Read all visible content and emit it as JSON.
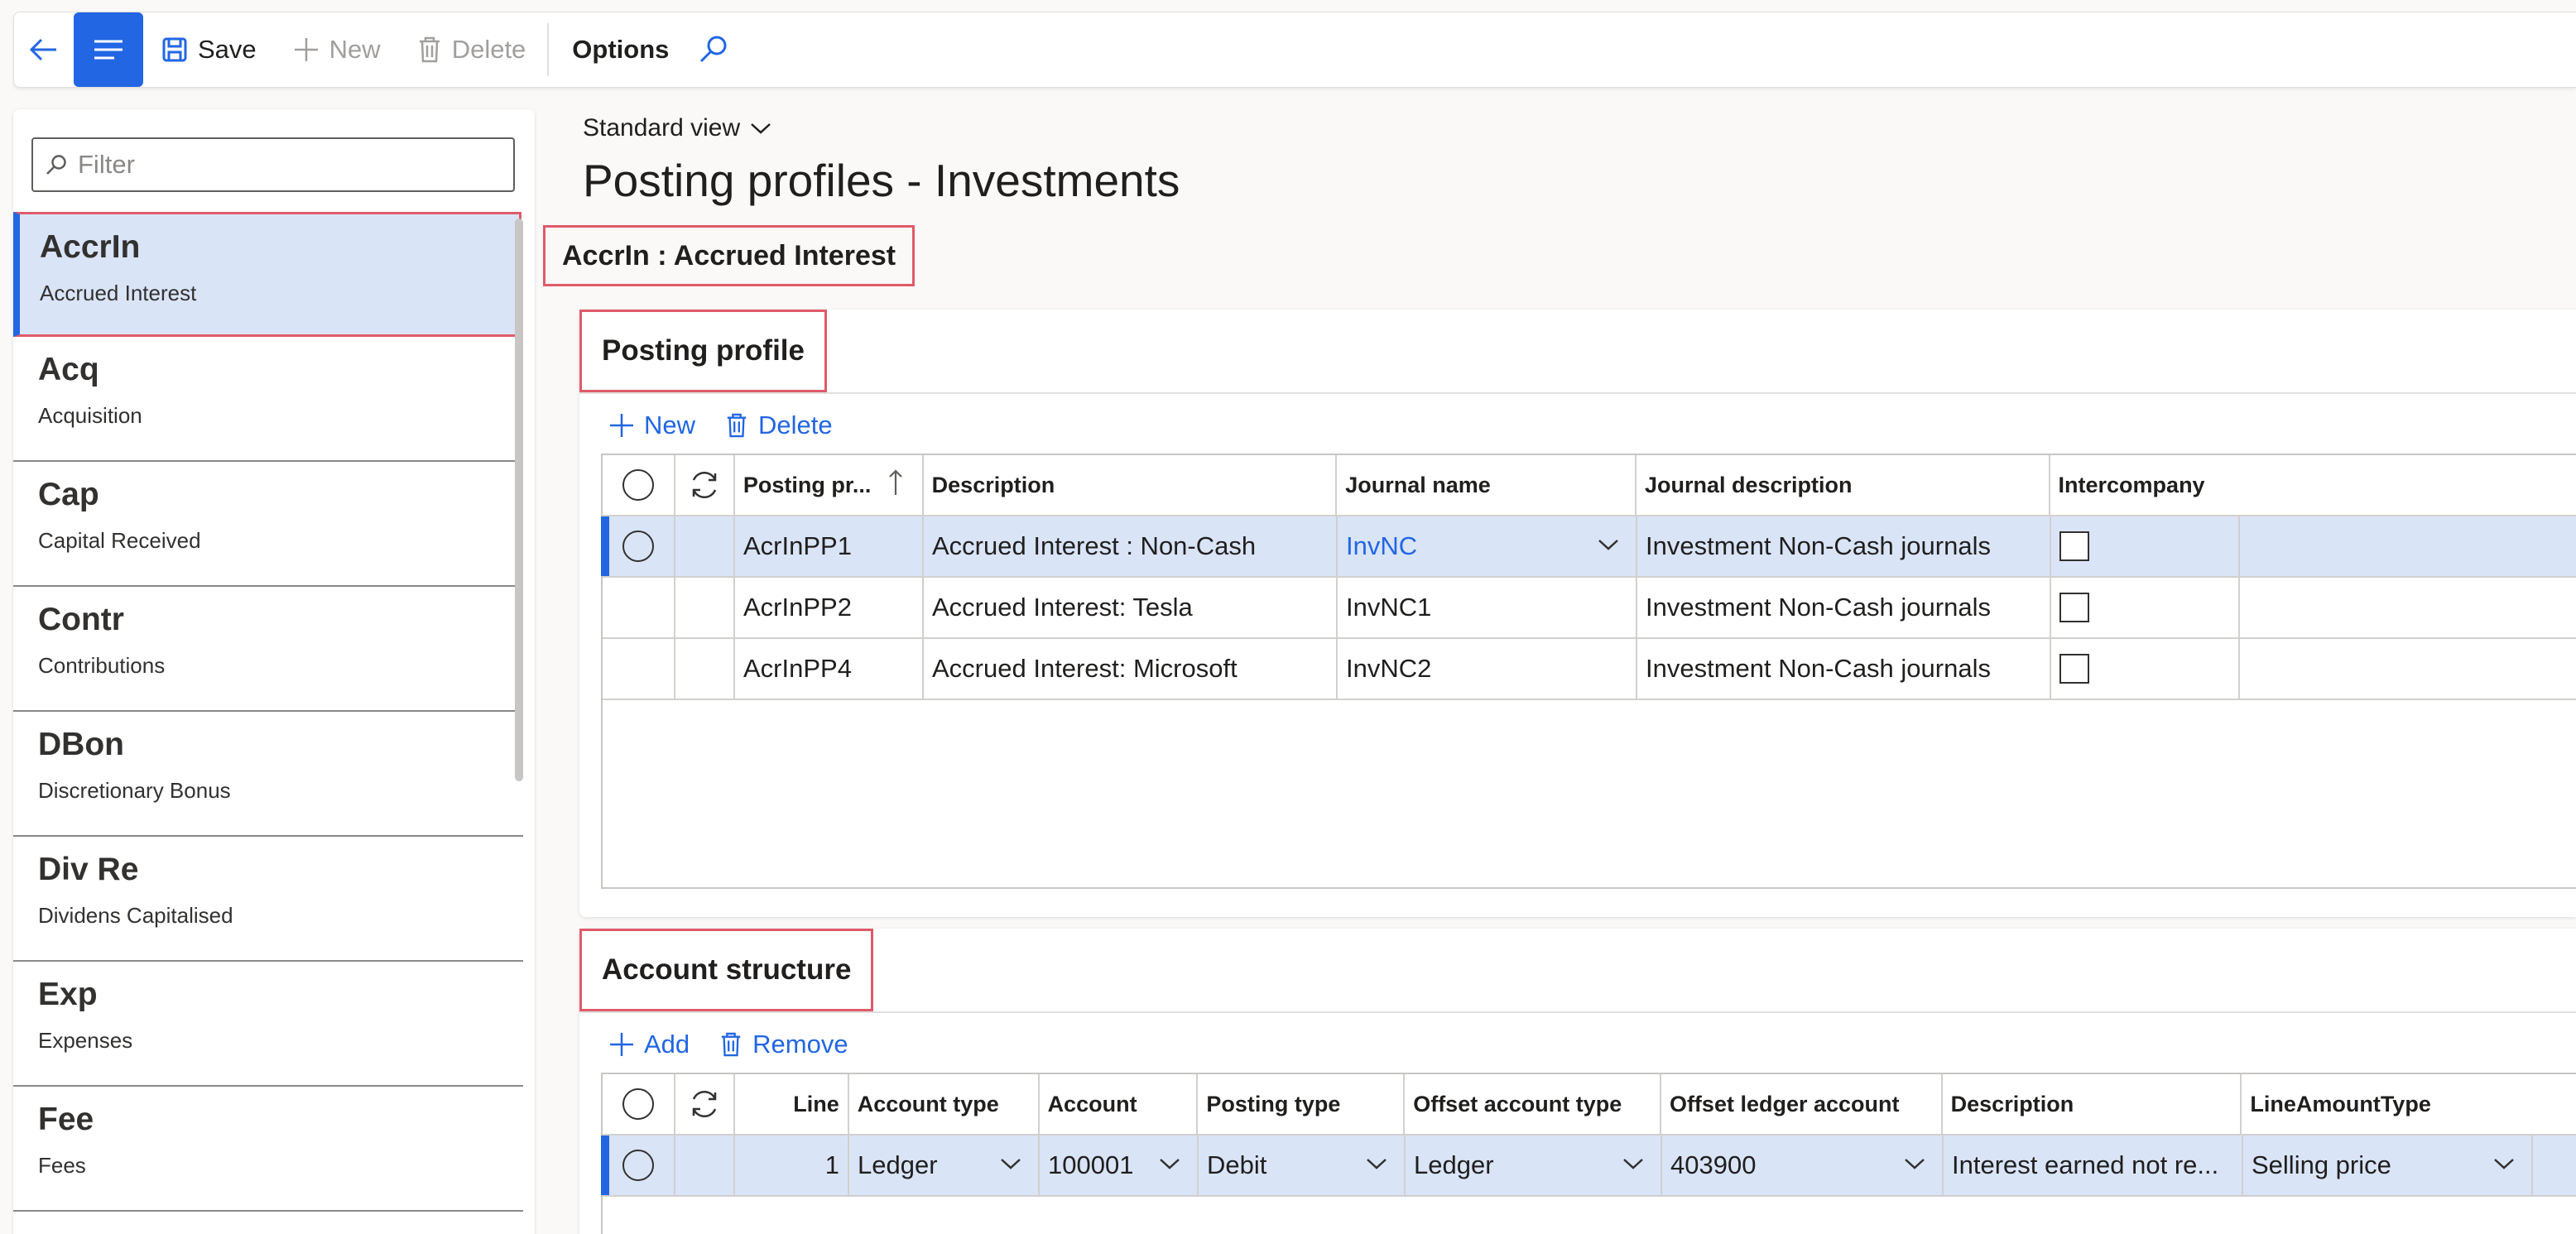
{
  "toolbar": {
    "save_label": "Save",
    "new_label": "New",
    "delete_label": "Delete",
    "options_label": "Options"
  },
  "filter": {
    "placeholder": "Filter"
  },
  "list": [
    {
      "code": "AccrIn",
      "desc": "Accrued Interest",
      "selected": true
    },
    {
      "code": "Acq",
      "desc": "Acquisition"
    },
    {
      "code": "Cap",
      "desc": "Capital Received"
    },
    {
      "code": "Contr",
      "desc": "Contributions"
    },
    {
      "code": "DBon",
      "desc": "Discretionary Bonus"
    },
    {
      "code": "Div Re",
      "desc": "Dividens Capitalised"
    },
    {
      "code": "Exp",
      "desc": "Expenses"
    },
    {
      "code": "Fee",
      "desc": "Fees"
    }
  ],
  "main": {
    "view_label": "Standard view",
    "page_title": "Posting profiles - Investments",
    "record_header": "AccrIn : Accrued Interest"
  },
  "posting_profile": {
    "title": "Posting profile",
    "new_label": "New",
    "delete_label": "Delete",
    "columns": [
      "Posting pr...",
      "Description",
      "Journal name",
      "Journal description",
      "Intercompany"
    ],
    "rows": [
      {
        "posting": "AcrInPP1",
        "description": "Accrued Interest : Non-Cash",
        "journal": "InvNC",
        "journal_desc": "Investment Non-Cash journals"
      },
      {
        "posting": "AcrInPP2",
        "description": "Accrued Interest: Tesla",
        "journal": "InvNC1",
        "journal_desc": "Investment Non-Cash journals"
      },
      {
        "posting": "AcrInPP4",
        "description": "Accrued Interest: Microsoft",
        "journal": "InvNC2",
        "journal_desc": "Investment Non-Cash journals"
      }
    ]
  },
  "account_structure": {
    "title": "Account structure",
    "add_label": "Add",
    "remove_label": "Remove",
    "columns": [
      "Line",
      "Account type",
      "Account",
      "Posting type",
      "Offset account type",
      "Offset ledger account",
      "Description",
      "LineAmountType"
    ],
    "rows": [
      {
        "line": "1",
        "account_type": "Ledger",
        "account": "100001",
        "posting_type": "Debit",
        "offset_type": "Ledger",
        "offset_account": "403900",
        "description": "Interest earned not re...",
        "line_amount_type": "Selling price"
      }
    ]
  },
  "colors": {
    "accent": "#2266e3",
    "selected_row": "#d9e4f7",
    "highlight_border": "#e05a6a"
  }
}
